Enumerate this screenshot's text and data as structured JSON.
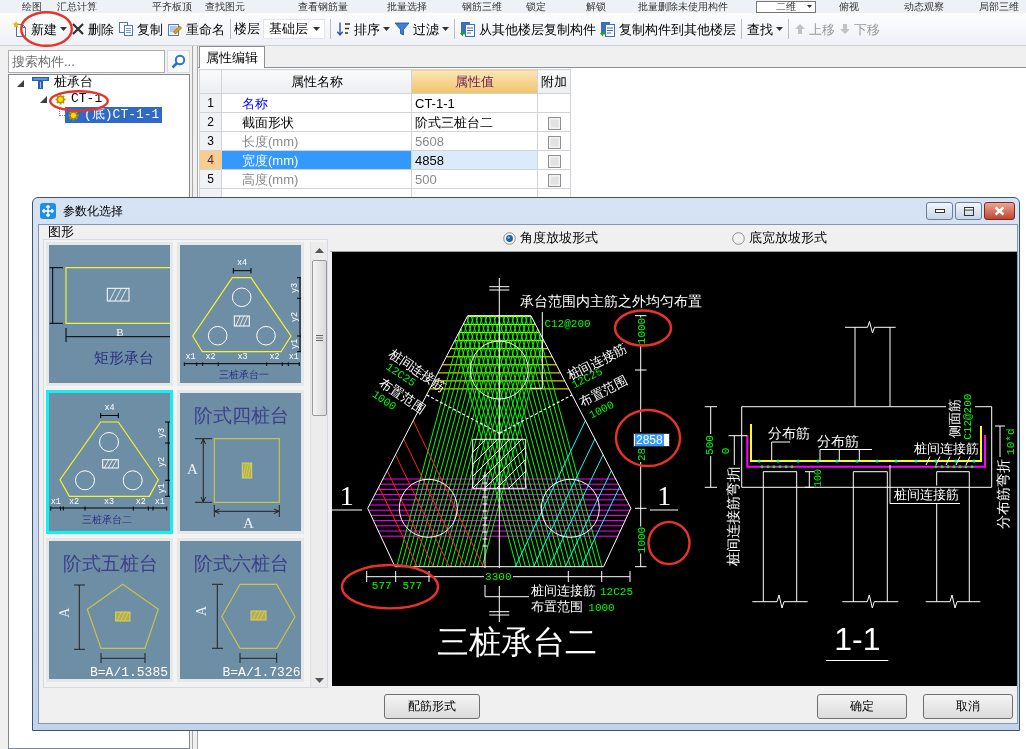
{
  "top_toolbar": [
    {
      "kind": "button",
      "label": "绘图"
    },
    {
      "kind": "button",
      "label": "汇总计算"
    },
    {
      "kind": "button",
      "label": "平齐板顶"
    },
    {
      "kind": "button",
      "label": "查找图元"
    },
    {
      "kind": "button",
      "label": "查看钢筋量"
    },
    {
      "kind": "button",
      "label": "批量选择"
    },
    {
      "kind": "button",
      "label": "钢筋三维"
    },
    {
      "kind": "button",
      "label": "锁定"
    },
    {
      "kind": "button",
      "label": "解锁"
    },
    {
      "kind": "button",
      "label": "批量删除未使用构件"
    },
    {
      "kind": "select",
      "label": "二维"
    },
    {
      "kind": "button",
      "label": "俯视"
    },
    {
      "kind": "button",
      "label": "动态观察"
    },
    {
      "kind": "button",
      "label": "局部三维"
    }
  ],
  "toolbar": [
    {
      "kind": "button",
      "label": "新建",
      "dropdown": true,
      "disabled": false
    },
    {
      "kind": "button",
      "label": "删除",
      "dropdown": false,
      "disabled": false
    },
    {
      "kind": "button",
      "label": "复制",
      "dropdown": false,
      "disabled": false
    },
    {
      "kind": "button",
      "label": "重命名",
      "dropdown": false,
      "disabled": false
    },
    {
      "kind": "separator"
    },
    {
      "kind": "label",
      "label": "楼层"
    },
    {
      "kind": "select",
      "value": "基础层"
    },
    {
      "kind": "separator"
    },
    {
      "kind": "button",
      "label": "排序",
      "dropdown": true,
      "disabled": false
    },
    {
      "kind": "button",
      "label": "过滤",
      "dropdown": true,
      "disabled": false
    },
    {
      "kind": "separator"
    },
    {
      "kind": "button",
      "label": "从其他楼层复制构件",
      "dropdown": false,
      "disabled": false
    },
    {
      "kind": "button",
      "label": "复制构件到其他楼层",
      "dropdown": false,
      "disabled": false
    },
    {
      "kind": "separator"
    },
    {
      "kind": "button",
      "label": "查找",
      "dropdown": true,
      "disabled": false
    },
    {
      "kind": "separator"
    },
    {
      "kind": "button",
      "label": "上移",
      "dropdown": false,
      "disabled": true
    },
    {
      "kind": "button",
      "label": "下移",
      "dropdown": false,
      "disabled": true
    }
  ],
  "left_panel": {
    "search": {
      "placeholder": "搜索构件..."
    },
    "tree": [
      {
        "kind": "group",
        "label": "桩承台",
        "expanded": true,
        "selected": false,
        "children": [
          {
            "kind": "item",
            "label": "CT-1",
            "expanded": true,
            "selected": false,
            "children": [
              {
                "kind": "item",
                "label": "(底)CT-1-1",
                "selected": true
              }
            ]
          }
        ]
      }
    ]
  },
  "property_panel": {
    "tabs": [
      {
        "label": "属性编辑",
        "selected": true
      }
    ],
    "table": {
      "columns": [
        {
          "label": "属性名称",
          "selected": false
        },
        {
          "label": "属性值",
          "selected": true
        },
        {
          "label": "附加",
          "selected": false
        }
      ],
      "rows": [
        {
          "number": "1",
          "name": "名称",
          "value": "CT-1-1",
          "kind": "title",
          "disabled": false,
          "selected": false
        },
        {
          "number": "2",
          "name": "截面形状",
          "value": "阶式三桩台二",
          "kind": "plain",
          "disabled": false,
          "selected": false,
          "checked": false
        },
        {
          "number": "3",
          "name": "长度(mm)",
          "value": "5608",
          "kind": "plain",
          "disabled": true,
          "selected": false,
          "checked": false
        },
        {
          "number": "4",
          "name": "宽度(mm)",
          "value": "4858",
          "kind": "plain",
          "disabled": false,
          "selected": true,
          "checked": false
        },
        {
          "number": "5",
          "name": "高度(mm)",
          "value": "500",
          "kind": "plain",
          "disabled": true,
          "selected": false,
          "checked": false
        }
      ]
    }
  },
  "dialog": {
    "title": "参数化选择",
    "group_label": "图形",
    "shapes": [
      {
        "kind": "rect",
        "title": "矩形承台",
        "selected": false,
        "labels": [
          "B"
        ]
      },
      {
        "kind": "three-pile-a",
        "title": "三桩承台一",
        "selected": false,
        "labels": [
          "x4",
          "y3",
          "y2",
          "y1",
          "x1",
          "x2",
          "x3",
          "x2",
          "x1"
        ]
      },
      {
        "kind": "three-pile-b",
        "title": "三桩承台二",
        "selected": true,
        "labels": [
          "x4",
          "y3",
          "y2",
          "y1",
          "x1",
          "x2",
          "x3",
          "x2",
          "x1"
        ]
      },
      {
        "kind": "square",
        "title": "阶式四桩台",
        "selected": false,
        "labels": [
          "A",
          "A"
        ]
      },
      {
        "kind": "pentagon",
        "title": "阶式五桩台",
        "selected": false,
        "labels": [
          "A"
        ],
        "formula": "B=A/1.5385"
      },
      {
        "kind": "hexagon",
        "title": "阶式六桩台",
        "selected": false,
        "labels": [
          "A"
        ],
        "formula": "B=A/1.7326"
      }
    ],
    "options": [
      {
        "label": "角度放坡形式",
        "selected": true
      },
      {
        "label": "底宽放坡形式",
        "selected": false
      }
    ],
    "drawing": {
      "plan_labels": [
        {
          "text": "承台范围内主筋之外均匀布置",
          "kind": "note"
        },
        {
          "text": "C12@200",
          "kind": "spec"
        },
        {
          "text": "桩间连接筋",
          "kind": "note"
        },
        {
          "text": "12C25",
          "kind": "spec"
        },
        {
          "text": "布置范围",
          "kind": "note"
        },
        {
          "text": "1000",
          "kind": "spec"
        },
        {
          "text": "桩间连接筋",
          "kind": "note"
        },
        {
          "text": "12C25",
          "kind": "spec"
        },
        {
          "text": "布置范围",
          "kind": "note"
        },
        {
          "text": "1000",
          "kind": "spec"
        },
        {
          "text": "1000",
          "kind": "dimension"
        },
        {
          "text": "28",
          "kind": "dimension"
        },
        {
          "text": "1000",
          "kind": "dimension"
        },
        {
          "text": "1",
          "kind": "section-mark"
        },
        {
          "text": "1",
          "kind": "section-mark"
        },
        {
          "text": "577",
          "kind": "dimension"
        },
        {
          "text": "577",
          "kind": "dimension"
        },
        {
          "text": "3300",
          "kind": "dimension"
        },
        {
          "text": "桩间连接筋",
          "kind": "note"
        },
        {
          "text": "12C25",
          "kind": "spec"
        },
        {
          "text": "布置范围",
          "kind": "note"
        },
        {
          "text": "1000",
          "kind": "spec"
        },
        {
          "text": "三桩承台二",
          "kind": "title"
        }
      ],
      "section_labels": [
        {
          "text": "分布筋",
          "kind": "note"
        },
        {
          "text": "分布筋",
          "kind": "note"
        },
        {
          "text": "桩间连接筋",
          "kind": "note"
        },
        {
          "text": "侧面筋",
          "kind": "note"
        },
        {
          "text": "C12@200",
          "kind": "spec"
        },
        {
          "text": "500",
          "kind": "dimension"
        },
        {
          "text": "0",
          "kind": "dimension"
        },
        {
          "text": "100",
          "kind": "dimension"
        },
        {
          "text": "桩间连接筋",
          "kind": "note"
        },
        {
          "text": "桩间连接筋弯折",
          "kind": "note"
        },
        {
          "text": "分布筋弯折",
          "kind": "note"
        },
        {
          "text": "10*d",
          "kind": "dimension"
        },
        {
          "text": "1-1",
          "kind": "title"
        }
      ],
      "dimension_input": {
        "value": "2858"
      }
    },
    "buttons": [
      {
        "label": "配筋形式"
      },
      {
        "label": "确定"
      },
      {
        "label": "取消"
      }
    ]
  }
}
